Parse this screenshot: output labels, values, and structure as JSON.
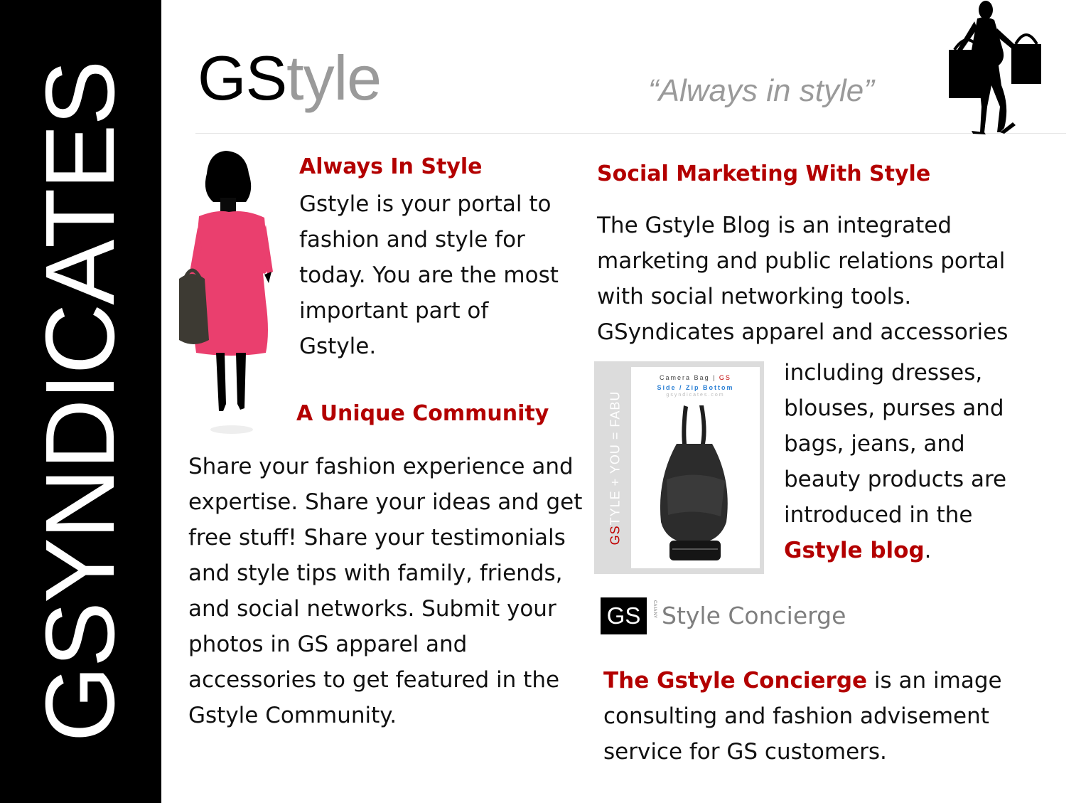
{
  "sidebar": {
    "brand": "GSYNDICATES"
  },
  "header": {
    "title_bold": "GS",
    "title_rest": "tyle",
    "tagline": "“Always in style”"
  },
  "left": {
    "heading1": "Always In Style",
    "para1": "Gstyle is your portal to fashion and style for today. You are the most important part of Gstyle.",
    "heading2": "A Unique Community",
    "para2": "Share your fashion experience and expertise. Share your ideas and get free stuff! Share your testimonials and style tips with family, friends, and social networks. Submit your photos in GS apparel and accessories to get featured in the Gstyle Community."
  },
  "right": {
    "heading": "Social Marketing With Style",
    "para1": "The Gstyle Blog is an integrated marketing and public relations portal with social networking tools. GSyndicates apparel and accessories",
    "para2": "including dresses, blouses, purses and bags, jeans, and beauty products are introduced in the",
    "blog_link": "Gstyle blog",
    "para2_end": ".",
    "bag_card": {
      "line1_a": "Camera Bag",
      "line1_sep": " | ",
      "line1_b": "GS",
      "line2": "Side / Zip Bottom",
      "line3": "gsyndicates.com",
      "vertical_gs": "GS",
      "vertical_rest": "TYLE + YOU = FABU"
    },
    "concierge_logo": {
      "gs": "GS",
      "states": "CA IA NY",
      "label": "Style Concierge"
    },
    "concierge_name": "The Gstyle Concierge",
    "concierge_text": " is an image consulting and fashion advisement service for GS customers."
  },
  "colors": {
    "accent": "#b30000",
    "grey": "#9a9a9a",
    "sidebar": "#000000"
  }
}
